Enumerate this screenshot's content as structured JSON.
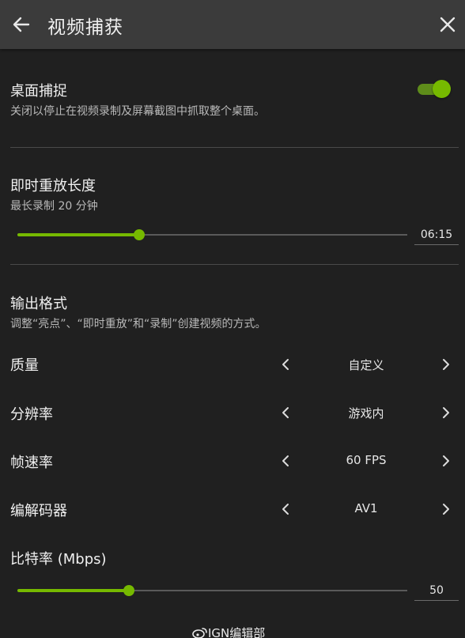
{
  "header": {
    "title": "视频捕获"
  },
  "desktop_capture": {
    "title": "桌面捕捉",
    "description": "关闭以停止在视频录制及屏幕截图中抓取整个桌面。",
    "enabled": true,
    "accent_color": "#76b900"
  },
  "instant_replay": {
    "title": "即时重放长度",
    "description": "最长录制 20 分钟",
    "value": "06:15",
    "slider_fraction": 0.3125
  },
  "output_format": {
    "title": "输出格式",
    "description": "调整“亮点”、“即时重放”和“录制”创建视频的方式。",
    "rows": [
      {
        "label": "质量",
        "value": "自定义"
      },
      {
        "label": "分辨率",
        "value": "游戏内"
      },
      {
        "label": "帧速率",
        "value": "60 FPS"
      },
      {
        "label": "编解码器",
        "value": "AV1"
      }
    ]
  },
  "bitrate": {
    "title": "比特率 (Mbps)",
    "value": "50",
    "slider_fraction": 0.286
  },
  "watermark": {
    "text": "IGN编辑部",
    "icon": "weibo-icon"
  },
  "icons": {
    "back": "arrow-left-icon",
    "close": "close-icon",
    "prev": "chevron-left-icon",
    "next": "chevron-right-icon"
  }
}
